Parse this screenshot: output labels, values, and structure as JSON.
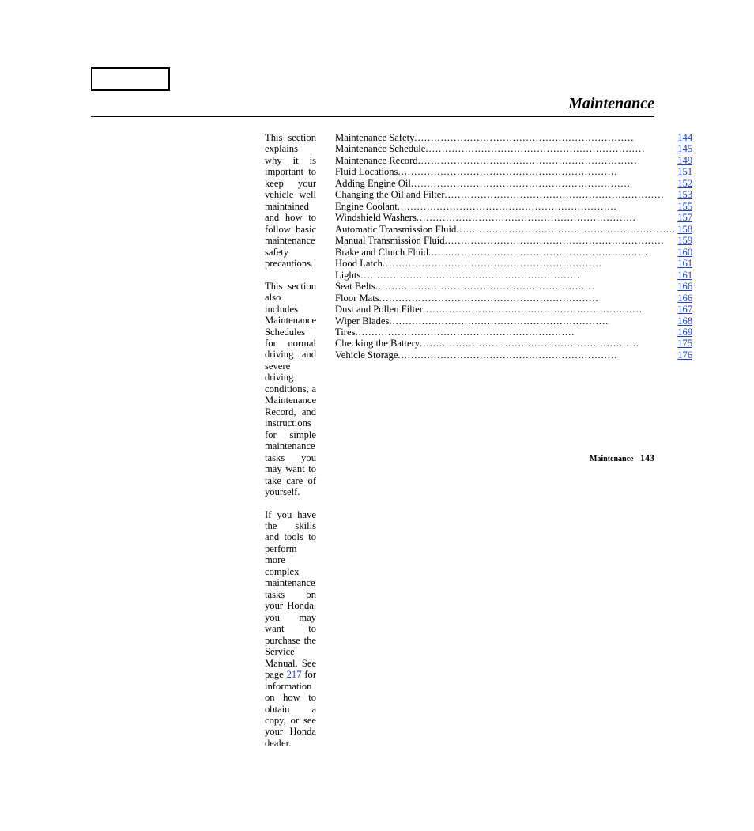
{
  "title": "Maintenance",
  "link_color": "#1a3fd6",
  "intro": {
    "p1": "This section explains why it is important to keep your vehicle well maintained and how to follow basic maintenance safety precautions.",
    "p2": "This section also includes Maintenance Schedules for normal driving and severe driving conditions, a Maintenance Record, and instructions for simple maintenance tasks you may want to take care of yourself.",
    "p3a": "If you have the skills and tools to perform more complex maintenance tasks on your Honda, you may want to purchase the Service Manual. See page ",
    "p3_link": "217",
    "p3b": " for information on how to obtain a copy, or see your Honda dealer."
  },
  "toc": [
    {
      "label": "Maintenance Safety",
      "page": "144"
    },
    {
      "label": "Maintenance Schedule",
      "page": "145"
    },
    {
      "label": "Maintenance Record",
      "page": "149"
    },
    {
      "label": "Fluid Locations",
      "page": "151"
    },
    {
      "label": "Adding Engine Oil",
      "page": "152"
    },
    {
      "label": "Changing the Oil and Filter",
      "page": "153"
    },
    {
      "label": "Engine Coolant",
      "page": "155"
    },
    {
      "label": "Windshield Washers",
      "page": "157"
    },
    {
      "label": "Automatic Transmission Fluid",
      "page": "158"
    },
    {
      "label": "Manual Transmission Fluid",
      "page": "159"
    },
    {
      "label": "Brake and Clutch Fluid",
      "page": "160"
    },
    {
      "label": "Hood Latch",
      "page": "161"
    },
    {
      "label": "Lights",
      "page": "161"
    },
    {
      "label": "Seat Belts",
      "page": "166"
    },
    {
      "label": "Floor Mats",
      "page": "166"
    },
    {
      "label": "Dust and Pollen Filter",
      "page": "167"
    },
    {
      "label": "Wiper Blades",
      "page": "168"
    },
    {
      "label": "Tires",
      "page": "169"
    },
    {
      "label": "Checking the Battery",
      "page": "175"
    },
    {
      "label": "Vehicle Storage",
      "page": "176"
    }
  ],
  "footer": {
    "section": "Maintenance",
    "page": "143"
  }
}
